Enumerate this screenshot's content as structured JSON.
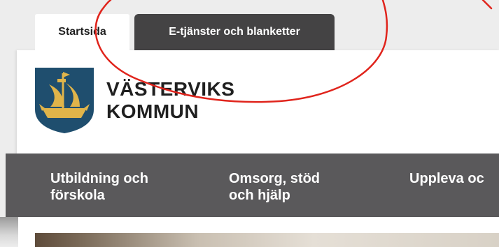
{
  "tabs": [
    {
      "label": "Startsida",
      "active": true
    },
    {
      "label": "E-tjänster och blanketter",
      "active": false
    }
  ],
  "brand": {
    "name_line1": "VÄSTERVIKS",
    "name_line2": "KOMMUN",
    "logo_icon": "ship-coat-of-arms-icon"
  },
  "nav": [
    {
      "line1": "Utbildning och",
      "line2": "förskola"
    },
    {
      "line1": "Omsorg, stöd",
      "line2": "och hjälp"
    },
    {
      "line1": "Uppleva oc",
      "line2": ""
    }
  ],
  "colors": {
    "nav_bar": "#5a595b",
    "tab_dark": "#444344",
    "shield_blue": "#1f4e6e",
    "emblem_gold": "#e0b44a",
    "annotation_red": "#e0241c"
  }
}
